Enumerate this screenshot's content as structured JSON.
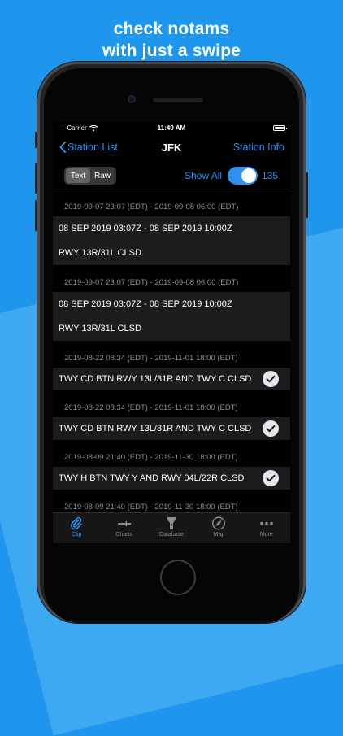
{
  "headline": [
    "check notams",
    "with just a swipe"
  ],
  "status_bar": {
    "carrier": "Carrier",
    "time": "11:49 AM"
  },
  "nav": {
    "back_label": "Station List",
    "title": "JFK",
    "right_label": "Station Info"
  },
  "toolbar": {
    "text_label": "Text",
    "raw_label": "Raw",
    "selected": "Text",
    "show_all_label": "Show All",
    "show_all_on": true,
    "count": "135"
  },
  "notams": [
    {
      "range": "2019-09-07 23:07 (EDT) - 2019-09-08 06:00 (EDT)",
      "lines": [
        "08 SEP 2019 03:07Z - 08 SEP 2019 10:00Z",
        "RWY 13R/31L CLSD"
      ],
      "checked": false
    },
    {
      "range": "2019-09-07 23:07 (EDT) - 2019-09-08 06:00 (EDT)",
      "lines": [
        "08 SEP 2019 03:07Z - 08 SEP 2019 10:00Z",
        "RWY 13R/31L CLSD"
      ],
      "checked": false
    },
    {
      "range": "2019-08-22 08:34 (EDT) - 2019-11-01 18:00 (EDT)",
      "lines": [
        "TWY CD BTN RWY 13L/31R AND TWY C CLSD"
      ],
      "checked": true
    },
    {
      "range": "2019-08-22 08:34 (EDT) - 2019-11-01 18:00 (EDT)",
      "lines": [
        "TWY CD BTN RWY 13L/31R AND TWY C CLSD"
      ],
      "checked": true
    },
    {
      "range": "2019-08-09 21:40 (EDT) - 2019-11-30 18:00 (EDT)",
      "lines": [
        "TWY H BTN TWY Y AND RWY 04L/22R CLSD"
      ],
      "checked": true
    },
    {
      "range": "2019-08-09 21:40 (EDT) - 2019-11-30 18:00 (EDT)",
      "lines": [],
      "checked": false
    }
  ],
  "page_indicator": {
    "count": 3,
    "active_index": 2
  },
  "tabs": [
    {
      "label": "Clip",
      "icon": "paperclip-icon",
      "active": true
    },
    {
      "label": "Charts",
      "icon": "charts-icon",
      "active": false
    },
    {
      "label": "Database",
      "icon": "flashlight-icon",
      "active": false
    },
    {
      "label": "Map",
      "icon": "compass-icon",
      "active": false
    },
    {
      "label": "More",
      "icon": "more-dots-icon",
      "active": false
    }
  ],
  "colors": {
    "background": "#1e96ee",
    "accent": "#2d8ff0",
    "cell": "#1c1c1e"
  }
}
